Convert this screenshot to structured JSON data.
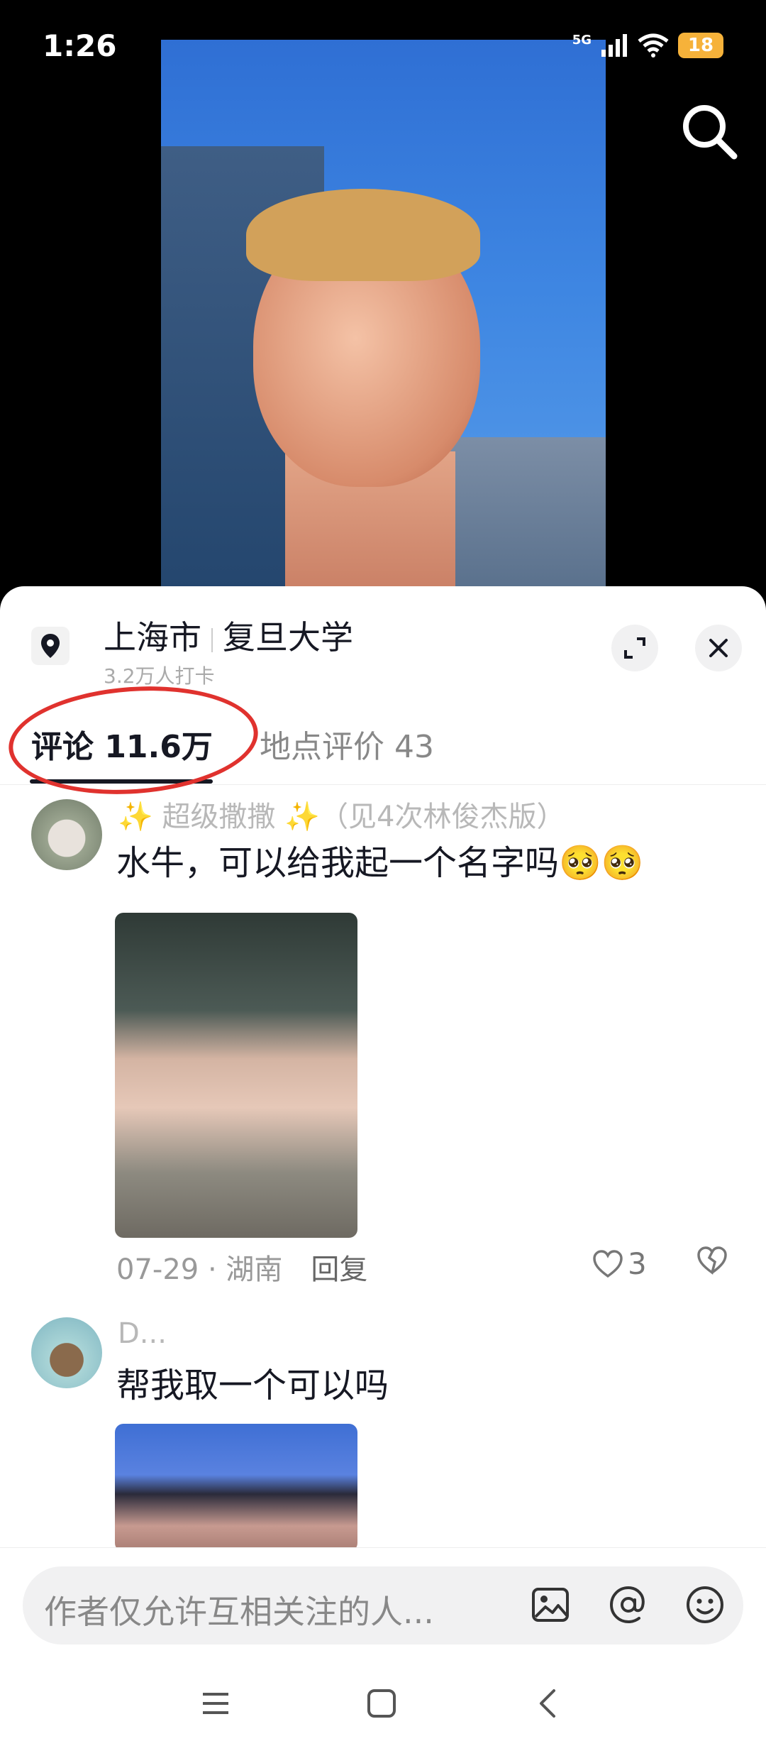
{
  "status_bar": {
    "time": "1:26",
    "network": "5G",
    "battery": "18"
  },
  "location": {
    "city": "上海市",
    "place": "复旦大学",
    "checkins": "3.2万人打卡"
  },
  "tabs": [
    {
      "label": "评论 11.6万",
      "active": true
    },
    {
      "label": "地点评价 43",
      "active": false
    }
  ],
  "comments": [
    {
      "author": "✨ 超级撒撒 ✨（见4次林俊杰版）",
      "text": "水牛，可以给我起一个名字吗🥺🥺",
      "date_region": "07-29 · 湖南",
      "reply_label": "回复",
      "likes": "3"
    },
    {
      "author": "D...",
      "text": "帮我取一个可以吗"
    }
  ],
  "input": {
    "placeholder": "作者仅允许互相关注的人..."
  },
  "colors": {
    "highlight_ring": "#e0322e",
    "battery": "#f6b23a",
    "sky": "#3e86e2"
  }
}
